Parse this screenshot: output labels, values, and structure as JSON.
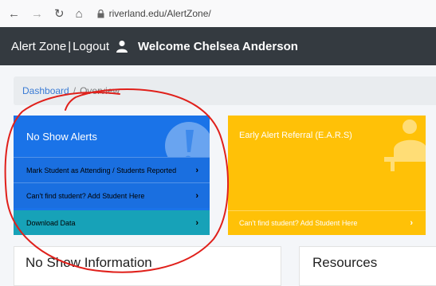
{
  "browser": {
    "url": "riverland.edu/AlertZone/",
    "icons": [
      "back-arrow-icon",
      "forward-arrow-icon",
      "reload-icon",
      "home-icon",
      "lock-icon"
    ]
  },
  "header": {
    "alert_zone": "Alert Zone",
    "separator": "|",
    "logout": "Logout",
    "welcome": "Welcome Chelsea Anderson",
    "background": "#343a40"
  },
  "breadcrumb": {
    "dashboard": "Dashboard",
    "separator": "/",
    "current": "Overview"
  },
  "no_show_card": {
    "title": "No Show Alerts",
    "items": [
      {
        "label": "Mark Student as Attending / Students Reported"
      },
      {
        "label": "Can't find student? Add Student Here"
      }
    ],
    "download_label": "Download Data",
    "color": "#1a73e8",
    "download_color": "#17a2b8"
  },
  "early_alert_card": {
    "title": "Early Alert Referral (E.A.R.S)",
    "item_label": "Can't find student? Add Student Here",
    "color": "#ffc107"
  },
  "no_show_info": {
    "title": "No Show Information"
  },
  "resources": {
    "title": "Resources"
  },
  "annotation_color": "#e0201b"
}
